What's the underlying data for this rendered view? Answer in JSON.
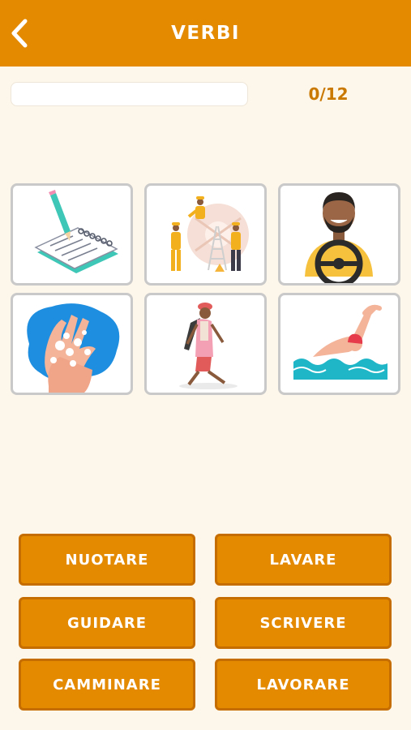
{
  "header": {
    "title": "VERBI",
    "back_icon": "chevron-left-icon",
    "color": "#e38a00"
  },
  "progress": {
    "counter_text": "0/12",
    "value": 0,
    "total": 12
  },
  "cards": [
    {
      "name": "card-writing",
      "illustration": "notebook-and-pencil"
    },
    {
      "name": "card-working",
      "illustration": "construction-workers"
    },
    {
      "name": "card-driving",
      "illustration": "man-with-steering-wheel"
    },
    {
      "name": "card-washing",
      "illustration": "hands-washing"
    },
    {
      "name": "card-walking",
      "illustration": "woman-walking"
    },
    {
      "name": "card-swimming",
      "illustration": "swimmer-in-water"
    }
  ],
  "answers": [
    {
      "label": "NUOTARE"
    },
    {
      "label": "LAVARE"
    },
    {
      "label": "GUIDARE"
    },
    {
      "label": "SCRIVERE"
    },
    {
      "label": "CAMMINARE"
    },
    {
      "label": "LAVORARE"
    }
  ],
  "colors": {
    "background": "#fdf6ea",
    "accent": "#e38a00",
    "card_border": "#c9c9c9"
  }
}
